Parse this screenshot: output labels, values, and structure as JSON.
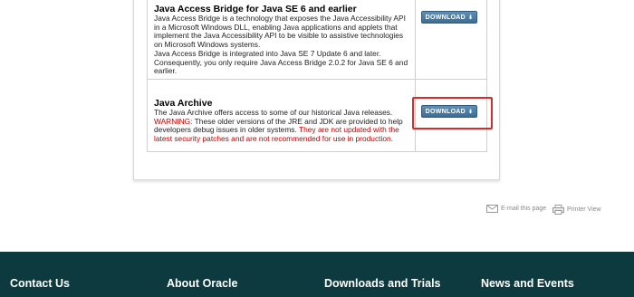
{
  "rows": [
    {
      "title": "Java Access Bridge for Java SE 6 and earlier",
      "lines": [
        "Java Access Bridge is a technology that exposes the Java Accessibility API",
        "in a Microsoft Windows DLL, enabling Java applications and applets that",
        "implement the Java Accessibility API to be visible to assistive technologies",
        "on Microsoft Windows systems.",
        "Java Access Bridge is integrated into Java SE 7 Update 6 and later.",
        "Consequently, you only require Java Access Bridge 2.0.2 for Java SE 6 and",
        "earlier."
      ],
      "button": "DOWNLOAD"
    },
    {
      "title": "Java Archive",
      "line1": "The Java Archive offers access to some of our historical Java releases.",
      "warning_label": "WARNING:",
      "line2_rest": " These older versions of the JRE and JDK are provided to help",
      "line3_a": "developers debug issues in older systems. ",
      "line3_b": "They are not updated with the",
      "line4": "latest security patches and are not recommended for use in production.",
      "button": "DOWNLOAD"
    }
  ],
  "tools": {
    "email": "E-mail this page",
    "print": "Printer View"
  },
  "footer": [
    "Contact Us",
    "About Oracle",
    "Downloads and Trials",
    "News and Events"
  ],
  "colors": {
    "footer_bg": "#0c3a3e",
    "warning": "#c00000",
    "button": "#3b6d95",
    "highlight": "#d62c2c"
  },
  "icons": [
    "download-arrow-icon",
    "envelope-icon",
    "printer-icon"
  ]
}
